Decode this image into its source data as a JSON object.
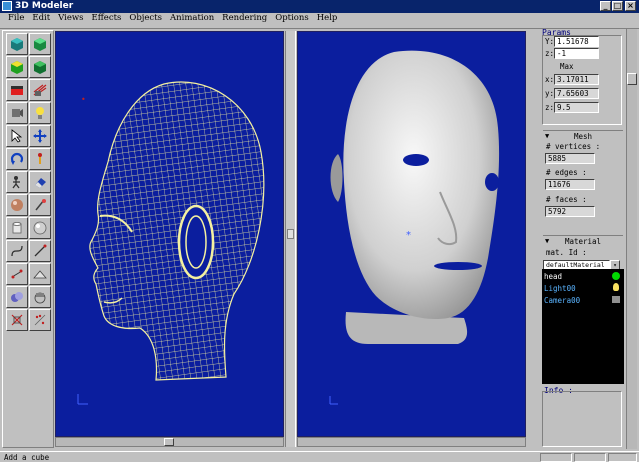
{
  "window": {
    "title": "3D Modeler"
  },
  "menu": [
    "File",
    "Edit",
    "Views",
    "Effects",
    "Objects",
    "Animation",
    "Rendering",
    "Options",
    "Help"
  ],
  "params": {
    "title": "Params",
    "y_label": "Y:",
    "y_value": "1.51678",
    "z_label": "z:",
    "z_value": "-1",
    "max_label": "Max",
    "max_x_label": "x:",
    "max_x": "3.17011",
    "max_y_label": "y:",
    "max_y": "7.65603",
    "max_z_label": "z:",
    "max_z": "9.5"
  },
  "mesh": {
    "title": "Mesh",
    "vertices_label": "# vertices :",
    "vertices": "5885",
    "edges_label": "# edges :",
    "edges": "11676",
    "faces_label": "# faces :",
    "faces": "5792"
  },
  "material": {
    "title": "Material",
    "id_label": "mat. Id :",
    "id_value": "defaultMaterial"
  },
  "scene_objects": [
    {
      "name": "head",
      "color": "#ffffff"
    },
    {
      "name": "Light00",
      "color": "#5ab4ff"
    },
    {
      "name": "Camera00",
      "color": "#5ab4ff"
    }
  ],
  "info": {
    "title": "Info :"
  },
  "status": {
    "message": "Add a cube"
  },
  "colors": {
    "viewport_bg": "#0b1e9e",
    "title_bar": "#08246b",
    "wire": "#f4f0a0",
    "select_dot": "#00d800"
  }
}
